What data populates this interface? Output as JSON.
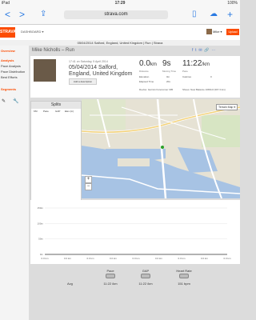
{
  "status": {
    "left": "iPad",
    "time": "17:29",
    "right": "100%"
  },
  "browser": {
    "url": "strava.com",
    "nav_back": "<",
    "nav_fwd": ">",
    "share": "⇪",
    "tabs": "+"
  },
  "header": {
    "logo": "STRAVA",
    "dashboard": "DASHBOARD ▾",
    "user": "Mike ▾",
    "upload": "Upload"
  },
  "page": {
    "title": "05/04/2014 Salford, England, United Kingdom | Run | Strava"
  },
  "sidebar": {
    "items": [
      {
        "label": "Overview",
        "head": true
      },
      {
        "label": "Analysis",
        "head": true
      },
      {
        "label": "Pace Analysis"
      },
      {
        "label": "Pace Distribution"
      },
      {
        "label": "Best Efforts"
      },
      {
        "label": "Segments",
        "head": true
      }
    ]
  },
  "activity": {
    "heading": "Mike Nicholls – Run",
    "date": "17:41 on Saturday, 5 April 2014",
    "name": "05/04/2014 Salford, England, United Kingdom",
    "add_desc": "Add a description",
    "distance": "0.0",
    "distance_unit": "km",
    "distance_label": "Distance",
    "moving_time": "9s",
    "moving_label": "Moving Time",
    "pace": "11:22",
    "pace_unit": "/km",
    "pace_label": "Pace",
    "elevation_label": "Elevation",
    "elevation": "0m",
    "calories_label": "Calories",
    "calories": "0",
    "elapsed_label": "Elapsed Time",
    "elapsed": "20s",
    "device": "Device: Garmin Forerunner 305",
    "shoes": "Shoes: New Balance 1080v3 (307.3 km)"
  },
  "splits": {
    "title": "Splits",
    "cols": [
      "KM",
      "Pace",
      "GAP",
      "Elev (m)"
    ]
  },
  "map": {
    "terrain": "Terrain Map ▾",
    "zoom_in": "+",
    "zoom_out": "−"
  },
  "chart_data": {
    "type": "area",
    "yticks": [
      "150m",
      "100m",
      "50m",
      "0m"
    ],
    "xticks": [
      "0.0 km",
      "0.0 km",
      "0.0 km",
      "0.0 km",
      "0.0 km",
      "0.0 km",
      "0.0 km",
      "0.0 km",
      "0.0 km"
    ],
    "values": [
      0,
      0,
      0,
      0,
      0,
      0,
      0,
      0,
      0
    ],
    "ylim": [
      0,
      150
    ]
  },
  "legend": {
    "items": [
      {
        "label": "Pace",
        "value": "11:22 /km"
      },
      {
        "label": "GAP",
        "value": "11:22 /km"
      },
      {
        "label": "Heart Rate",
        "value": "151 bpm"
      }
    ],
    "avg": "Avg"
  }
}
